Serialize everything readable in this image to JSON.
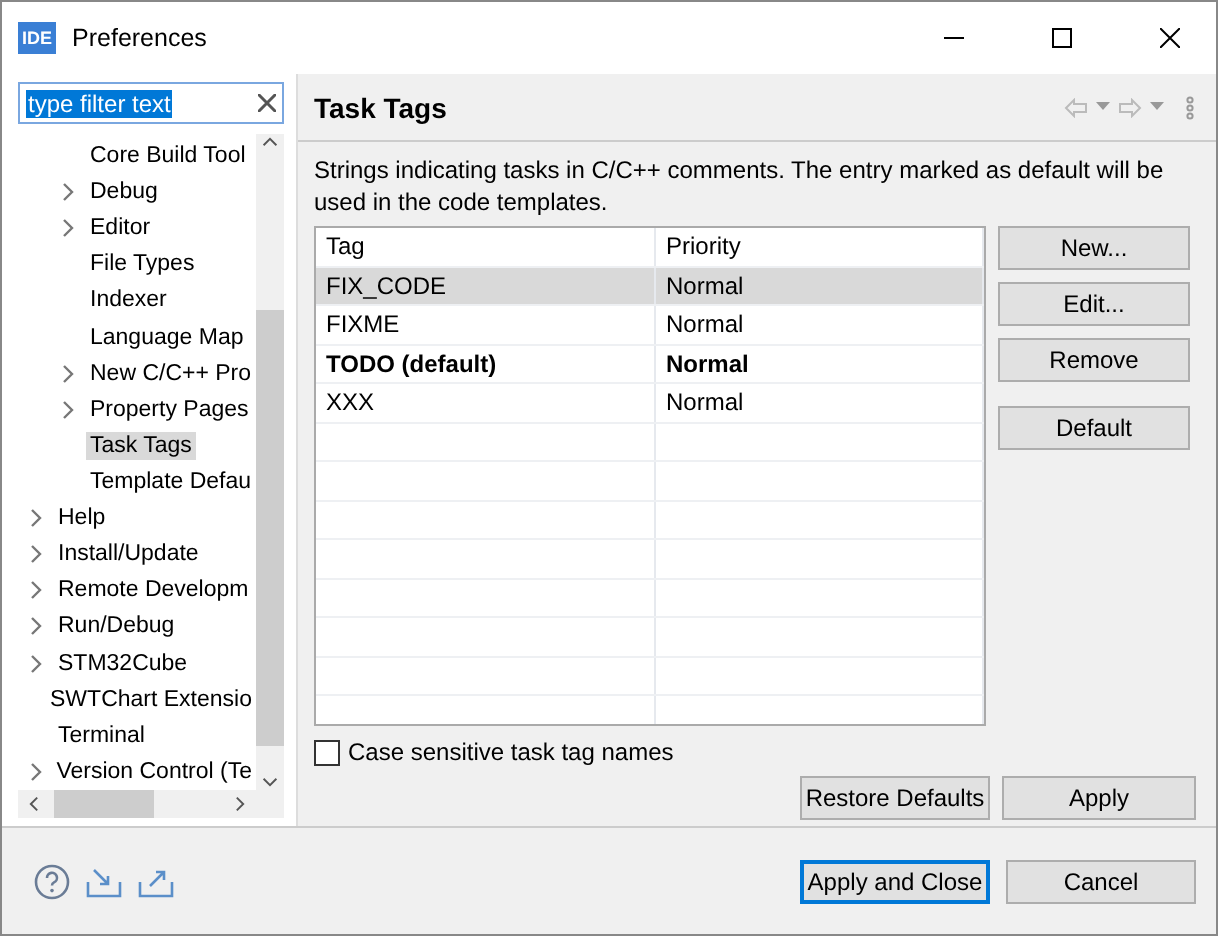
{
  "window": {
    "logo": "IDE",
    "title": "Preferences"
  },
  "filter": {
    "value": "type filter text"
  },
  "tree": [
    {
      "children": [
        {
          "label": "Core Build Tool",
          "expandable": false,
          "selected": false
        },
        {
          "label": "Debug",
          "expandable": true,
          "selected": false
        },
        {
          "label": "Editor",
          "expandable": true,
          "selected": false
        },
        {
          "label": "File Types",
          "expandable": false,
          "selected": false
        },
        {
          "label": "Indexer",
          "expandable": false,
          "selected": false
        },
        {
          "label": "Language Map",
          "expandable": false,
          "selected": false
        },
        {
          "label": "New C/C++ Pro",
          "expandable": true,
          "selected": false
        },
        {
          "label": "Property Pages",
          "expandable": true,
          "selected": false
        },
        {
          "label": "Task Tags",
          "expandable": false,
          "selected": true
        },
        {
          "label": "Template Defau",
          "expandable": false,
          "selected": false
        }
      ]
    },
    {
      "label": "Help",
      "expandable": true,
      "selected": false
    },
    {
      "label": "Install/Update",
      "expandable": true,
      "selected": false
    },
    {
      "label": "Remote Developm",
      "expandable": true,
      "selected": false
    },
    {
      "label": "Run/Debug",
      "expandable": true,
      "selected": false
    },
    {
      "label": "STM32Cube",
      "expandable": true,
      "selected": false
    },
    {
      "label": "SWTChart Extensio",
      "expandable": false,
      "selected": false
    },
    {
      "label": "Terminal",
      "expandable": false,
      "selected": false
    },
    {
      "label": "Version Control (Te",
      "expandable": true,
      "selected": false
    }
  ],
  "page": {
    "title": "Task Tags",
    "description": "Strings indicating tasks in C/C++ comments. The entry marked as default will be used in the code templates."
  },
  "table": {
    "columns": [
      "Tag",
      "Priority"
    ],
    "rows": [
      {
        "tag": "FIX_CODE",
        "priority": "Normal",
        "selected": true,
        "default": false
      },
      {
        "tag": "FIXME",
        "priority": "Normal",
        "selected": false,
        "default": false
      },
      {
        "tag": "TODO (default)",
        "priority": "Normal",
        "selected": false,
        "default": true
      },
      {
        "tag": "XXX",
        "priority": "Normal",
        "selected": false,
        "default": false
      }
    ]
  },
  "side_buttons": [
    "New...",
    "Edit...",
    "Remove",
    "Default"
  ],
  "case_sensitive": {
    "label": "Case sensitive task tag names",
    "checked": false
  },
  "page_buttons": [
    "Restore Defaults",
    "Apply"
  ],
  "dialog_buttons": [
    {
      "label": "Apply and Close",
      "default": true
    },
    {
      "label": "Cancel",
      "default": false
    }
  ]
}
